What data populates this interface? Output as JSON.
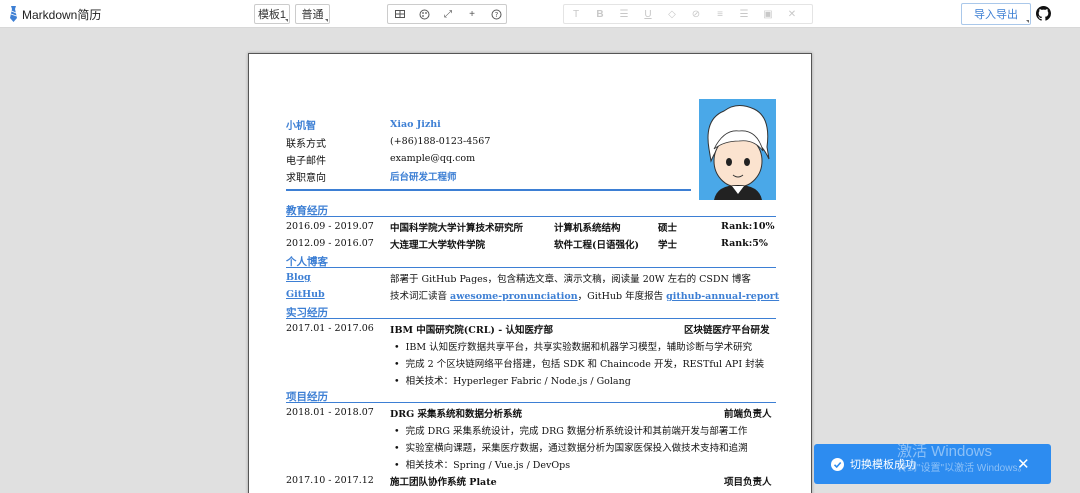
{
  "app": {
    "title": "Markdown简历"
  },
  "toolbar": {
    "template_label": "模板1",
    "mode_label": "普通",
    "export_label": "导入导出"
  },
  "resume": {
    "name_label": "小机智",
    "name_value": "Xiao Jizhi",
    "contact_label": "联系方式",
    "contact_value": "(+86)188-0123-4567",
    "email_label": "电子邮件",
    "email_value": "example@qq.com",
    "intent_label": "求职意向",
    "intent_value": "后台研发工程师",
    "education": {
      "title": "教育经历",
      "rows": [
        {
          "period": "2016.09 - 2019.07",
          "school": "中国科学院大学计算技术研究所",
          "major": "计算机系统结构",
          "degree": "硕士",
          "rank": "Rank:10%"
        },
        {
          "period": "2012.09 - 2016.07",
          "school": "大连理工大学软件学院",
          "major": "软件工程(日语强化)",
          "degree": "学士",
          "rank": "Rank:5%"
        }
      ]
    },
    "blog": {
      "title": "个人博客",
      "blog_link": "Blog",
      "github_link": "GitHub",
      "line1": "部署于 GitHub Pages，包含精选文章、演示文稿，阅读量 20W 左右的 CSDN 博客",
      "line2_prefix": "技术词汇读音",
      "line2_link1": "awesome-pronunciation",
      "line2_mid": "，GitHub 年度报告",
      "line2_link2": "github-annual-report"
    },
    "internship": {
      "title": "实习经历",
      "period": "2017.01 - 2017.06",
      "org": "IBM 中国研究院(CRL) - 认知医疗部",
      "role": "区块链医疗平台研发",
      "bullets": [
        "IBM 认知医疗数据共享平台，共享实验数据和机器学习模型，辅助诊断与学术研究",
        "完成 2 个区块链网络平台搭建，包括 SDK 和 Chaincode 开发，RESTful API 封装",
        "相关技术：Hyperleger Fabric / Node.js / Golang"
      ]
    },
    "projects": {
      "title": "项目经历",
      "p1_period": "2018.01 - 2018.07",
      "p1_name": "DRG 采集系统和数据分析系统",
      "p1_role": "前端负责人",
      "p1_bullets": [
        "完成 DRG 采集系统设计，完成 DRG 数据分析系统设计和其前端开发与部署工作",
        "实验室横向课题，采集医疗数据，通过数据分析为国家医保投入做技术支持和追溯",
        "相关技术：Spring / Vue.js / DevOps"
      ],
      "p2_period": "2017.10 - 2017.12",
      "p2_name": "施工团队协作系统 Plate",
      "p2_role": "项目负责人"
    }
  },
  "toast": {
    "message": "切换模板成功"
  },
  "watermark": {
    "line1": "激活 Windows",
    "line2": "转到\"设置\"以激活 Windows。"
  },
  "colors": {
    "accent": "#3d7fd4",
    "toast_bg": "#2d8cf0"
  }
}
